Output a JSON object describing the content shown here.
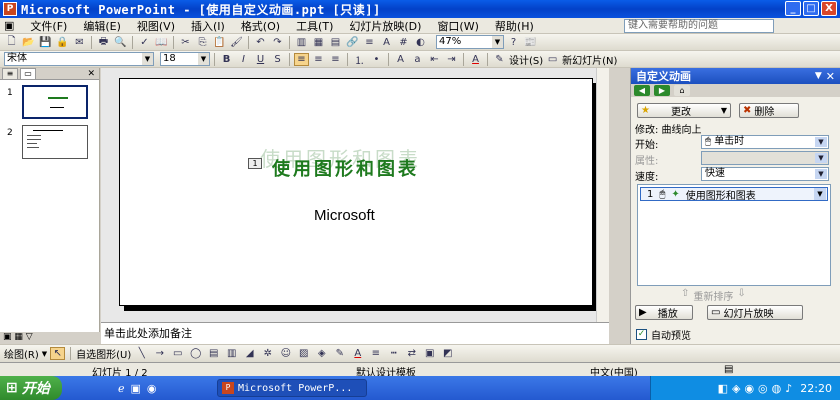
{
  "window": {
    "title": "Microsoft PowerPoint - [使用自定义动画.ppt [只读]]",
    "minimize": "_",
    "maximize": "□",
    "close": "X"
  },
  "menu": {
    "items": [
      "文件(F)",
      "编辑(E)",
      "视图(V)",
      "插入(I)",
      "格式(O)",
      "工具(T)",
      "幻灯片放映(D)",
      "窗口(W)",
      "帮助(H)"
    ],
    "help_placeholder": "键入需要帮助的问题"
  },
  "toolbar": {
    "zoom": "47%",
    "design_label": "设计(S)",
    "new_slide_label": "新幻灯片(N)"
  },
  "format_bar": {
    "font": "宋体",
    "size": "18",
    "bold": "B",
    "italic": "I",
    "underline": "U",
    "shadow": "S",
    "font_color_label": "A"
  },
  "slides_pane": {
    "thumbs": [
      {
        "num": "1"
      },
      {
        "num": "2"
      }
    ]
  },
  "slide": {
    "title": "使用图形和图表",
    "ghost_title": "使用图形和图表",
    "subtitle": "Microsoft",
    "anim_tag": "1"
  },
  "notes": {
    "placeholder": "单击此处添加备注"
  },
  "task_pane": {
    "title": "自定义动画",
    "change_label": "更改",
    "delete_label": "删除",
    "modify_label": "修改: 曲线向上",
    "start_label": "开始:",
    "start_value": "单击时",
    "property_label": "属性:",
    "speed_label": "速度:",
    "speed_value": "快速",
    "list": [
      {
        "order": "1",
        "name": "使用图形和图表"
      }
    ],
    "reorder_label": "重新排序",
    "play_label": "播放",
    "slideshow_label": "幻灯片放映",
    "autopreview_label": "自动预览"
  },
  "drawbar": {
    "draw_label": "绘图(R)",
    "autoshape_label": "自选图形(U)"
  },
  "status": {
    "slide_count": "幻灯片 1 / 2",
    "template": "默认设计模板",
    "language": "中文(中国)"
  },
  "taskbar": {
    "start_label": "开始",
    "task_label": "Microsoft PowerP...",
    "clock": "22:20"
  },
  "colors": {
    "title_bar": "#0a52de",
    "slide_title": "#1e7a1e",
    "task_pane_header": "#2a5bd0"
  }
}
